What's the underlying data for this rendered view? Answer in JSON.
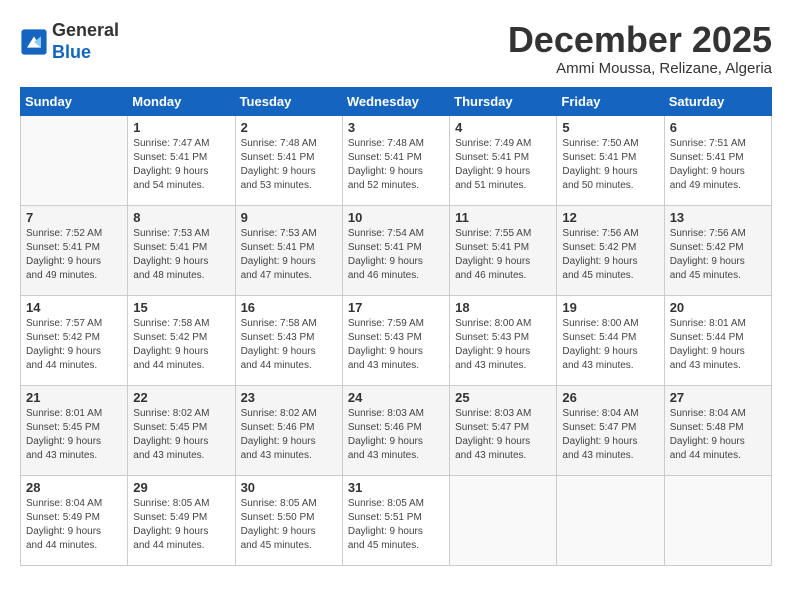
{
  "logo": {
    "general": "General",
    "blue": "Blue"
  },
  "header": {
    "month": "December 2025",
    "location": "Ammi Moussa, Relizane, Algeria"
  },
  "weekdays": [
    "Sunday",
    "Monday",
    "Tuesday",
    "Wednesday",
    "Thursday",
    "Friday",
    "Saturday"
  ],
  "weeks": [
    [
      {
        "day": "",
        "info": ""
      },
      {
        "day": "1",
        "info": "Sunrise: 7:47 AM\nSunset: 5:41 PM\nDaylight: 9 hours\nand 54 minutes."
      },
      {
        "day": "2",
        "info": "Sunrise: 7:48 AM\nSunset: 5:41 PM\nDaylight: 9 hours\nand 53 minutes."
      },
      {
        "day": "3",
        "info": "Sunrise: 7:48 AM\nSunset: 5:41 PM\nDaylight: 9 hours\nand 52 minutes."
      },
      {
        "day": "4",
        "info": "Sunrise: 7:49 AM\nSunset: 5:41 PM\nDaylight: 9 hours\nand 51 minutes."
      },
      {
        "day": "5",
        "info": "Sunrise: 7:50 AM\nSunset: 5:41 PM\nDaylight: 9 hours\nand 50 minutes."
      },
      {
        "day": "6",
        "info": "Sunrise: 7:51 AM\nSunset: 5:41 PM\nDaylight: 9 hours\nand 49 minutes."
      }
    ],
    [
      {
        "day": "7",
        "info": "Sunrise: 7:52 AM\nSunset: 5:41 PM\nDaylight: 9 hours\nand 49 minutes."
      },
      {
        "day": "8",
        "info": "Sunrise: 7:53 AM\nSunset: 5:41 PM\nDaylight: 9 hours\nand 48 minutes."
      },
      {
        "day": "9",
        "info": "Sunrise: 7:53 AM\nSunset: 5:41 PM\nDaylight: 9 hours\nand 47 minutes."
      },
      {
        "day": "10",
        "info": "Sunrise: 7:54 AM\nSunset: 5:41 PM\nDaylight: 9 hours\nand 46 minutes."
      },
      {
        "day": "11",
        "info": "Sunrise: 7:55 AM\nSunset: 5:41 PM\nDaylight: 9 hours\nand 46 minutes."
      },
      {
        "day": "12",
        "info": "Sunrise: 7:56 AM\nSunset: 5:42 PM\nDaylight: 9 hours\nand 45 minutes."
      },
      {
        "day": "13",
        "info": "Sunrise: 7:56 AM\nSunset: 5:42 PM\nDaylight: 9 hours\nand 45 minutes."
      }
    ],
    [
      {
        "day": "14",
        "info": "Sunrise: 7:57 AM\nSunset: 5:42 PM\nDaylight: 9 hours\nand 44 minutes."
      },
      {
        "day": "15",
        "info": "Sunrise: 7:58 AM\nSunset: 5:42 PM\nDaylight: 9 hours\nand 44 minutes."
      },
      {
        "day": "16",
        "info": "Sunrise: 7:58 AM\nSunset: 5:43 PM\nDaylight: 9 hours\nand 44 minutes."
      },
      {
        "day": "17",
        "info": "Sunrise: 7:59 AM\nSunset: 5:43 PM\nDaylight: 9 hours\nand 43 minutes."
      },
      {
        "day": "18",
        "info": "Sunrise: 8:00 AM\nSunset: 5:43 PM\nDaylight: 9 hours\nand 43 minutes."
      },
      {
        "day": "19",
        "info": "Sunrise: 8:00 AM\nSunset: 5:44 PM\nDaylight: 9 hours\nand 43 minutes."
      },
      {
        "day": "20",
        "info": "Sunrise: 8:01 AM\nSunset: 5:44 PM\nDaylight: 9 hours\nand 43 minutes."
      }
    ],
    [
      {
        "day": "21",
        "info": "Sunrise: 8:01 AM\nSunset: 5:45 PM\nDaylight: 9 hours\nand 43 minutes."
      },
      {
        "day": "22",
        "info": "Sunrise: 8:02 AM\nSunset: 5:45 PM\nDaylight: 9 hours\nand 43 minutes."
      },
      {
        "day": "23",
        "info": "Sunrise: 8:02 AM\nSunset: 5:46 PM\nDaylight: 9 hours\nand 43 minutes."
      },
      {
        "day": "24",
        "info": "Sunrise: 8:03 AM\nSunset: 5:46 PM\nDaylight: 9 hours\nand 43 minutes."
      },
      {
        "day": "25",
        "info": "Sunrise: 8:03 AM\nSunset: 5:47 PM\nDaylight: 9 hours\nand 43 minutes."
      },
      {
        "day": "26",
        "info": "Sunrise: 8:04 AM\nSunset: 5:47 PM\nDaylight: 9 hours\nand 43 minutes."
      },
      {
        "day": "27",
        "info": "Sunrise: 8:04 AM\nSunset: 5:48 PM\nDaylight: 9 hours\nand 44 minutes."
      }
    ],
    [
      {
        "day": "28",
        "info": "Sunrise: 8:04 AM\nSunset: 5:49 PM\nDaylight: 9 hours\nand 44 minutes."
      },
      {
        "day": "29",
        "info": "Sunrise: 8:05 AM\nSunset: 5:49 PM\nDaylight: 9 hours\nand 44 minutes."
      },
      {
        "day": "30",
        "info": "Sunrise: 8:05 AM\nSunset: 5:50 PM\nDaylight: 9 hours\nand 45 minutes."
      },
      {
        "day": "31",
        "info": "Sunrise: 8:05 AM\nSunset: 5:51 PM\nDaylight: 9 hours\nand 45 minutes."
      },
      {
        "day": "",
        "info": ""
      },
      {
        "day": "",
        "info": ""
      },
      {
        "day": "",
        "info": ""
      }
    ]
  ]
}
